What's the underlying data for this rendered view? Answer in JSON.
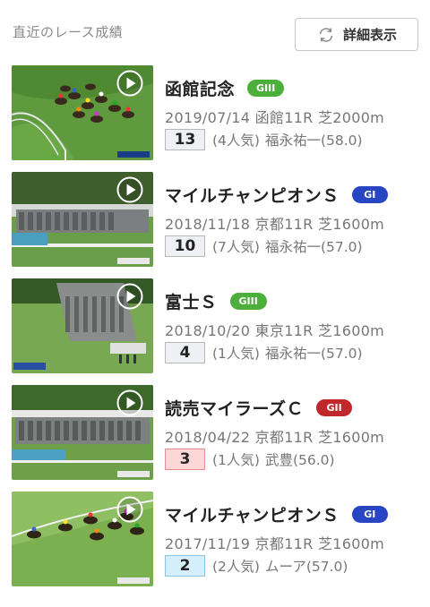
{
  "header": {
    "title": "直近のレース成績",
    "detail_button": "詳細表示",
    "detail_icon": "refresh-icon"
  },
  "colors": {
    "grade_green": "#4cae3b",
    "grade_blue": "#2845c4",
    "grade_red": "#c0282b",
    "place_pink": "#fbd7d7",
    "place_blue": "#d5eefb"
  },
  "races": [
    {
      "name": "函館記念",
      "grade": "GIII",
      "info": "2019/07/14 函館11R 芝2000m",
      "place": "13",
      "popularity": "(4人気)",
      "jockey": "福永祐一(58.0)"
    },
    {
      "name": "マイルチャンピオンＳ",
      "grade": "GI",
      "info": "2018/11/18 京都11R 芝1600m",
      "place": "10",
      "popularity": "(7人気)",
      "jockey": "福永祐一(57.0)"
    },
    {
      "name": "富士Ｓ",
      "grade": "GIII",
      "info": "2018/10/20 東京11R 芝1600m",
      "place": "4",
      "popularity": "(1人気)",
      "jockey": "福永祐一(57.0)"
    },
    {
      "name": "読売マイラーズＣ",
      "grade": "GII",
      "info": "2018/04/22 京都11R 芝1600m",
      "place": "3",
      "popularity": "(1人気)",
      "jockey": "武豊(56.0)"
    },
    {
      "name": "マイルチャンピオンＳ",
      "grade": "GI",
      "info": "2017/11/19 京都11R 芝1600m",
      "place": "2",
      "popularity": "(2人気)",
      "jockey": "ムーア(57.0)"
    }
  ]
}
